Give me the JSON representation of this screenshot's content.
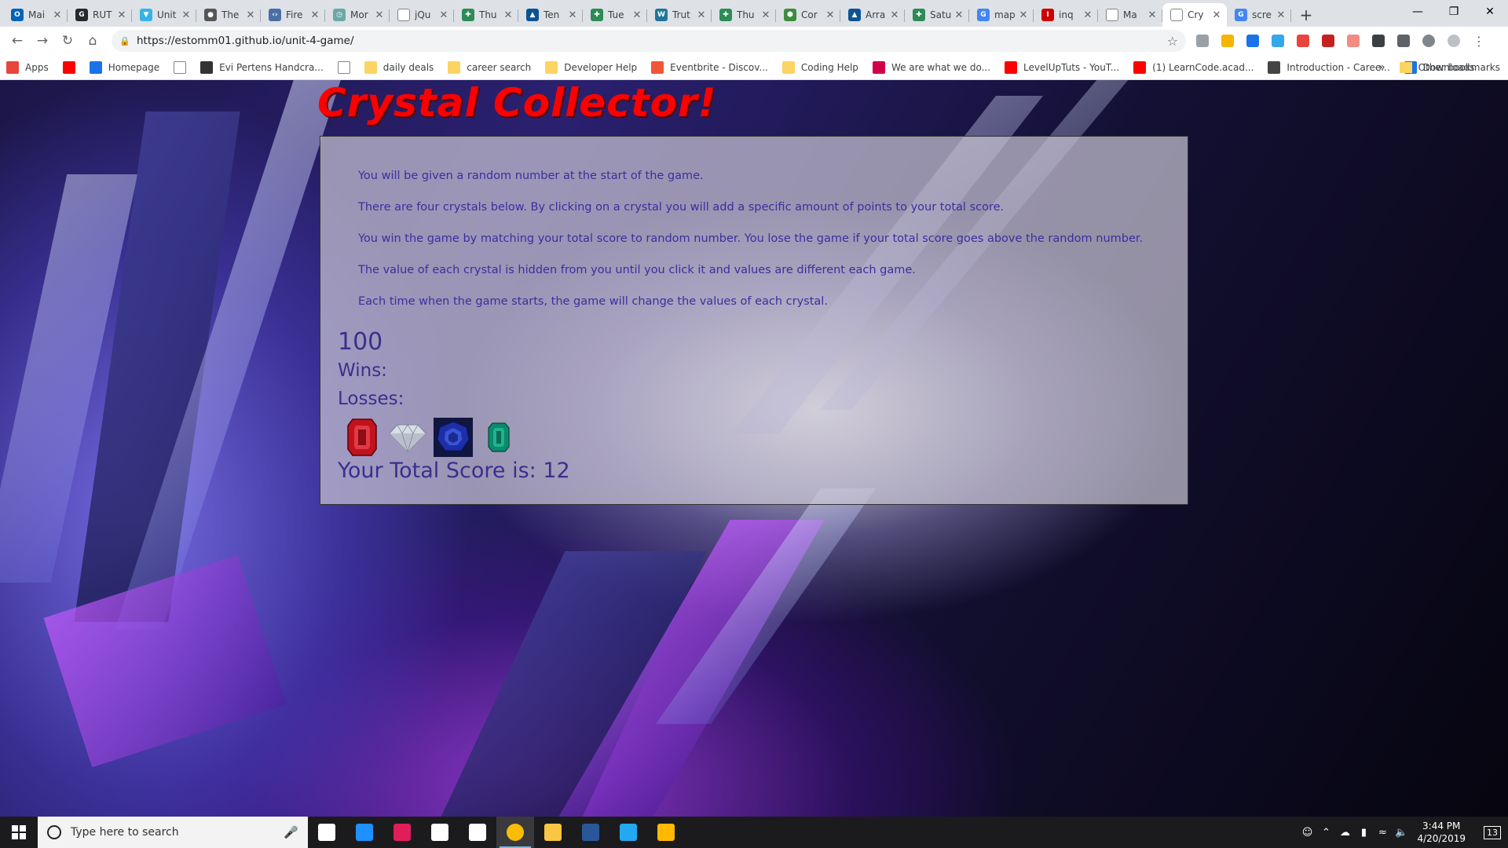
{
  "browser": {
    "tabs": [
      {
        "title": "Mai",
        "color": "#0364b8",
        "glyph": "O"
      },
      {
        "title": "RUT",
        "color": "#24292e",
        "glyph": "G"
      },
      {
        "title": "Unit",
        "color": "#33b5e5",
        "glyph": "▼"
      },
      {
        "title": "The",
        "color": "#555555",
        "glyph": "●"
      },
      {
        "title": "Fire",
        "color": "#4a6fa5",
        "glyph": "‹›"
      },
      {
        "title": "Mor",
        "color": "#6aa8a8",
        "glyph": "◷"
      },
      {
        "title": "jQu",
        "color": "#ffffff",
        "glyph": ""
      },
      {
        "title": "Thu",
        "color": "#2e8b57",
        "glyph": "✚"
      },
      {
        "title": "Ten",
        "color": "#0b5394",
        "glyph": "▲"
      },
      {
        "title": "Tue",
        "color": "#2e8b57",
        "glyph": "✚"
      },
      {
        "title": "Trut",
        "color": "#21759b",
        "glyph": "W"
      },
      {
        "title": "Thu",
        "color": "#2e8b57",
        "glyph": "✚"
      },
      {
        "title": "Cor",
        "color": "#3c8d3c",
        "glyph": "⬢"
      },
      {
        "title": "Arra",
        "color": "#0b5394",
        "glyph": "▲"
      },
      {
        "title": "Satu",
        "color": "#2e8b57",
        "glyph": "✚"
      },
      {
        "title": "map",
        "color": "#4285f4",
        "glyph": "G"
      },
      {
        "title": "inq",
        "color": "#cc0000",
        "glyph": "I"
      },
      {
        "title": "Ma",
        "color": "#ffffff",
        "glyph": ""
      },
      {
        "title": "Cry",
        "color": "#ffffff",
        "glyph": "",
        "active": true
      },
      {
        "title": "scre",
        "color": "#4285f4",
        "glyph": "G"
      }
    ],
    "url": "https://estomm01.github.io/unit-4-game/",
    "bookmarks": [
      {
        "label": "Apps",
        "color": "#e8453c"
      },
      {
        "label": "",
        "color": "#ff0000"
      },
      {
        "label": "Homepage",
        "color": "#1a73e8"
      },
      {
        "label": "",
        "color": "#ffffff"
      },
      {
        "label": "Evi Pertens Handcra...",
        "color": "#333333"
      },
      {
        "label": "",
        "color": "#ffffff"
      },
      {
        "label": "daily deals",
        "color": "folder"
      },
      {
        "label": "career search",
        "color": "folder"
      },
      {
        "label": "Developer Help",
        "color": "folder"
      },
      {
        "label": "Eventbrite - Discov...",
        "color": "#f05537"
      },
      {
        "label": "Coding Help",
        "color": "folder"
      },
      {
        "label": "We are what we do...",
        "color": "#d2004b"
      },
      {
        "label": "LevelUpTuts - YouT...",
        "color": "#ff0000"
      },
      {
        "label": "(1) LearnCode.acad...",
        "color": "#ff0000"
      },
      {
        "label": "Introduction - Caree...",
        "color": "#444444"
      },
      {
        "label": "Downloads",
        "color": "#1a73e8"
      }
    ],
    "bookmarks_overflow": "»",
    "other_bookmarks": "Other bookmarks"
  },
  "game": {
    "title": "Crystal Collector!",
    "instructions": [
      "You will be given a random number at the start of the game.",
      "There are four crystals below. By clicking on a crystal you will add a specific amount of points to your total score.",
      "You win the game by matching your total score to random number. You lose the game if your total score goes above the random number.",
      "The value of each crystal is hidden from you until you click it and values are different each game.",
      "Each time when the game starts, the game will change the values of each crystal."
    ],
    "random_number": "100",
    "wins_label": "Wins:",
    "losses_label": "Losses:",
    "crystals": [
      {
        "name": "ruby-crystal",
        "color": "#c0131e"
      },
      {
        "name": "diamond-crystal",
        "color": "#d8dde6"
      },
      {
        "name": "sapphire-crystal",
        "color": "#1c2fa8"
      },
      {
        "name": "emerald-crystal",
        "color": "#0b8a6e"
      }
    ],
    "total_score_text": "Your Total Score is: 12"
  },
  "taskbar": {
    "search_placeholder": "Type here to search",
    "apps": [
      {
        "name": "task-view-icon",
        "color": "#ffffff"
      },
      {
        "name": "edge-icon",
        "color": "#1e90ff"
      },
      {
        "name": "slack-icon",
        "color": "#e01e5a"
      },
      {
        "name": "store-icon",
        "color": "#ffffff"
      },
      {
        "name": "mail-icon",
        "color": "#ffffff"
      },
      {
        "name": "chrome-icon",
        "color": "#fbbc05",
        "active": true
      },
      {
        "name": "file-explorer-icon",
        "color": "#f8c642"
      },
      {
        "name": "word-icon",
        "color": "#2b579a"
      },
      {
        "name": "vscode-icon",
        "color": "#23a9f2"
      },
      {
        "name": "paint-icon",
        "color": "#ffb900"
      }
    ],
    "time": "3:44 PM",
    "date": "4/20/2019",
    "notifications": "13"
  }
}
